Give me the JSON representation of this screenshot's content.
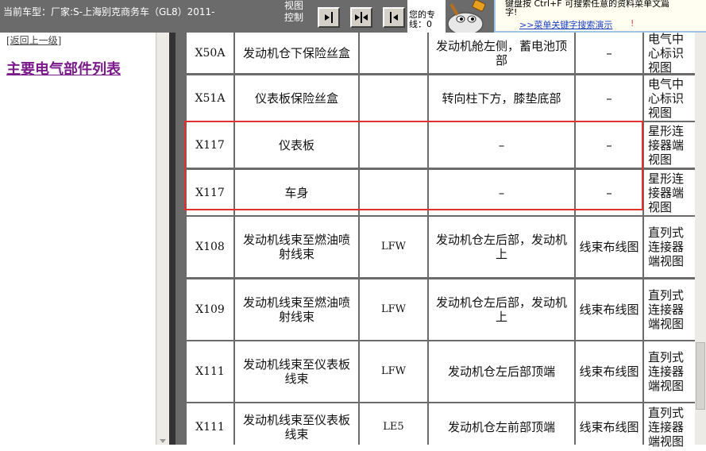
{
  "header": {
    "car_model": "当前车型：厂家:S-上海别克商务车（GL8）2011-",
    "view_control": "视图控制",
    "message_line1": "您的专",
    "message_line2": "线：0",
    "hint_line1": "键盘按 Ctrl+F 可搜索任意的资料菜单文篇",
    "hint_line2": "字!",
    "hint_link": ">>菜单关键字搜索演示",
    "hint_mark": "!"
  },
  "sidebar": {
    "back_link": "[返回上一级]",
    "title": "主要电气部件列表"
  },
  "table": {
    "rows": [
      {
        "code": "X50A",
        "name": "发动机仓下保险丝盒",
        "type": "",
        "location": "发动机舱左侧，蓄电池顶部",
        "view": "–",
        "diagram": "电气中心标识视图"
      },
      {
        "code": "X51A",
        "name": "仪表板保险丝盒",
        "type": "",
        "location": "转向柱下方，膝垫底部",
        "view": "–",
        "diagram": "电气中心标识视图"
      },
      {
        "code": "X117",
        "name": "仪表板",
        "type": "",
        "location": "–",
        "view": "–",
        "diagram": "星形连接器端视图"
      },
      {
        "code": "X117",
        "name": "车身",
        "type": "",
        "location": "–",
        "view": "–",
        "diagram": "星形连接器端视图"
      },
      {
        "code": "X108",
        "name": "发动机线束至燃油喷射线束",
        "type": "LFW",
        "location": "发动机仓左后部，发动机上",
        "view": "线束布线图",
        "diagram": "直列式连接器端视图"
      },
      {
        "code": "X109",
        "name": "发动机线束至燃油喷射线束",
        "type": "LFW",
        "location": "发动机仓左后部，发动机上",
        "view": "线束布线图",
        "diagram": "直列式连接器端视图"
      },
      {
        "code": "X111",
        "name": "发动机线束至仪表板线束",
        "type": "LFW",
        "location": "发动机仓左后部顶端",
        "view": "线束布线图",
        "diagram": "直列式连接器端视图"
      },
      {
        "code": "X111",
        "name": "发动机线束至仪表板线束",
        "type": "LE5",
        "location": "发动机仓左前部顶端",
        "view": "线束布线图",
        "diagram": "直列式连接器端视图"
      }
    ]
  },
  "colors": {
    "toolbar_bg": "#6b6b6b",
    "title_purple": "#7a1a8a",
    "highlight_red": "#e03030",
    "link_blue": "#1a3fc4"
  },
  "icons": {
    "nav_prev": "frame-left-icon",
    "nav_both": "frame-both-icon",
    "nav_next": "frame-right-icon",
    "mascot": "mascot-icon"
  }
}
